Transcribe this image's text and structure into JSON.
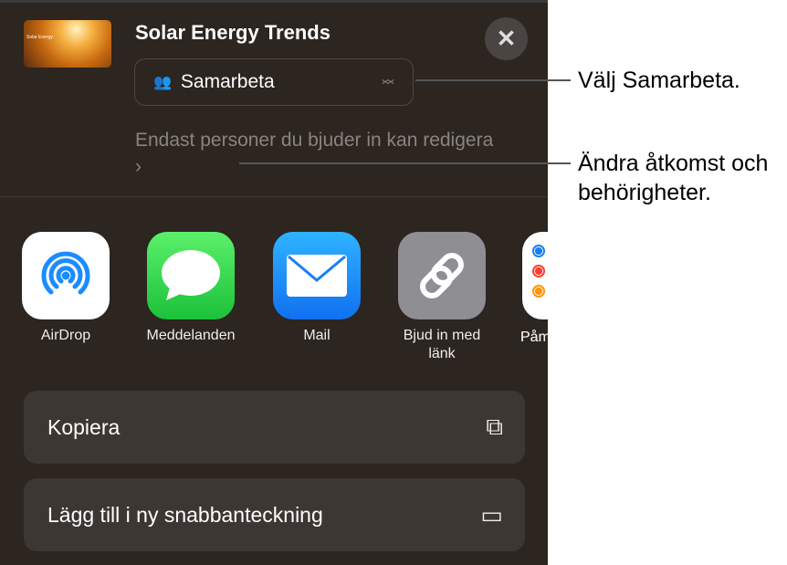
{
  "header": {
    "title": "Solar Energy Trends",
    "thumbnail_text": "Solar Energy",
    "close_icon": "close-icon"
  },
  "collab_select": {
    "value": "Samarbeta",
    "icon": "people-icon"
  },
  "access_text": "Endast personer du bjuder in kan redigera",
  "apps": [
    {
      "label": "AirDrop",
      "icon": "airdrop-icon"
    },
    {
      "label": "Meddelanden",
      "icon": "messages-icon"
    },
    {
      "label": "Mail",
      "icon": "mail-icon"
    },
    {
      "label": "Bjud in med länk",
      "icon": "link-icon"
    },
    {
      "label": "Påminnelser",
      "icon": "reminders-icon"
    }
  ],
  "apps_visible_last": "Påm",
  "actions": [
    {
      "label": "Kopiera",
      "icon": "copy-icon"
    },
    {
      "label": "Lägg till i ny snabbanteckning",
      "icon": "quick-note-icon"
    }
  ],
  "callouts": [
    "Välj Samarbeta.",
    "Ändra åtkomst och behörigheter."
  ]
}
